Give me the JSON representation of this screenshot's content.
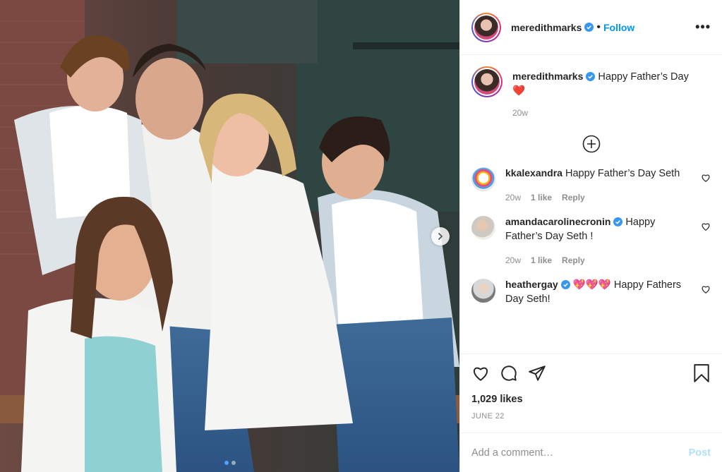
{
  "post": {
    "username": "meredithmarks",
    "follow_label": "Follow",
    "separator": "•",
    "more_label": "•••",
    "caption_text": "Happy Father’s Day",
    "caption_emoji": "❤️",
    "caption_age": "20w"
  },
  "comments": [
    {
      "username": "kkalexandra",
      "text": "Happy Father’s Day Seth",
      "age": "20w",
      "likes": "1 like",
      "reply": "Reply",
      "verified": false
    },
    {
      "username": "amandacarolinecronin",
      "text": "Happy Father’s Day Seth !",
      "age": "20w",
      "likes": "1 like",
      "reply": "Reply",
      "verified": true
    },
    {
      "username": "heathergay",
      "text": "💖💖💖 Happy Fathers Day Seth!",
      "age": "",
      "likes": "",
      "reply": "",
      "verified": true
    }
  ],
  "engagement": {
    "likes": "1,029 likes",
    "date": "JUNE 22"
  },
  "composer": {
    "placeholder": "Add a comment…",
    "post_label": "Post"
  },
  "carousel": {
    "slides": 2,
    "active": 1
  },
  "icons": {
    "verified": "verified-badge-icon",
    "heart": "heart-icon",
    "comment": "comment-bubble-icon",
    "share": "paper-plane-icon",
    "save": "bookmark-icon",
    "next": "chevron-right-icon",
    "add": "plus-circle-icon"
  },
  "colors": {
    "accent": "#0095f6",
    "verified": "#3897f0",
    "muted": "#8e8e8e",
    "post_disabled": "#b2dffc"
  }
}
